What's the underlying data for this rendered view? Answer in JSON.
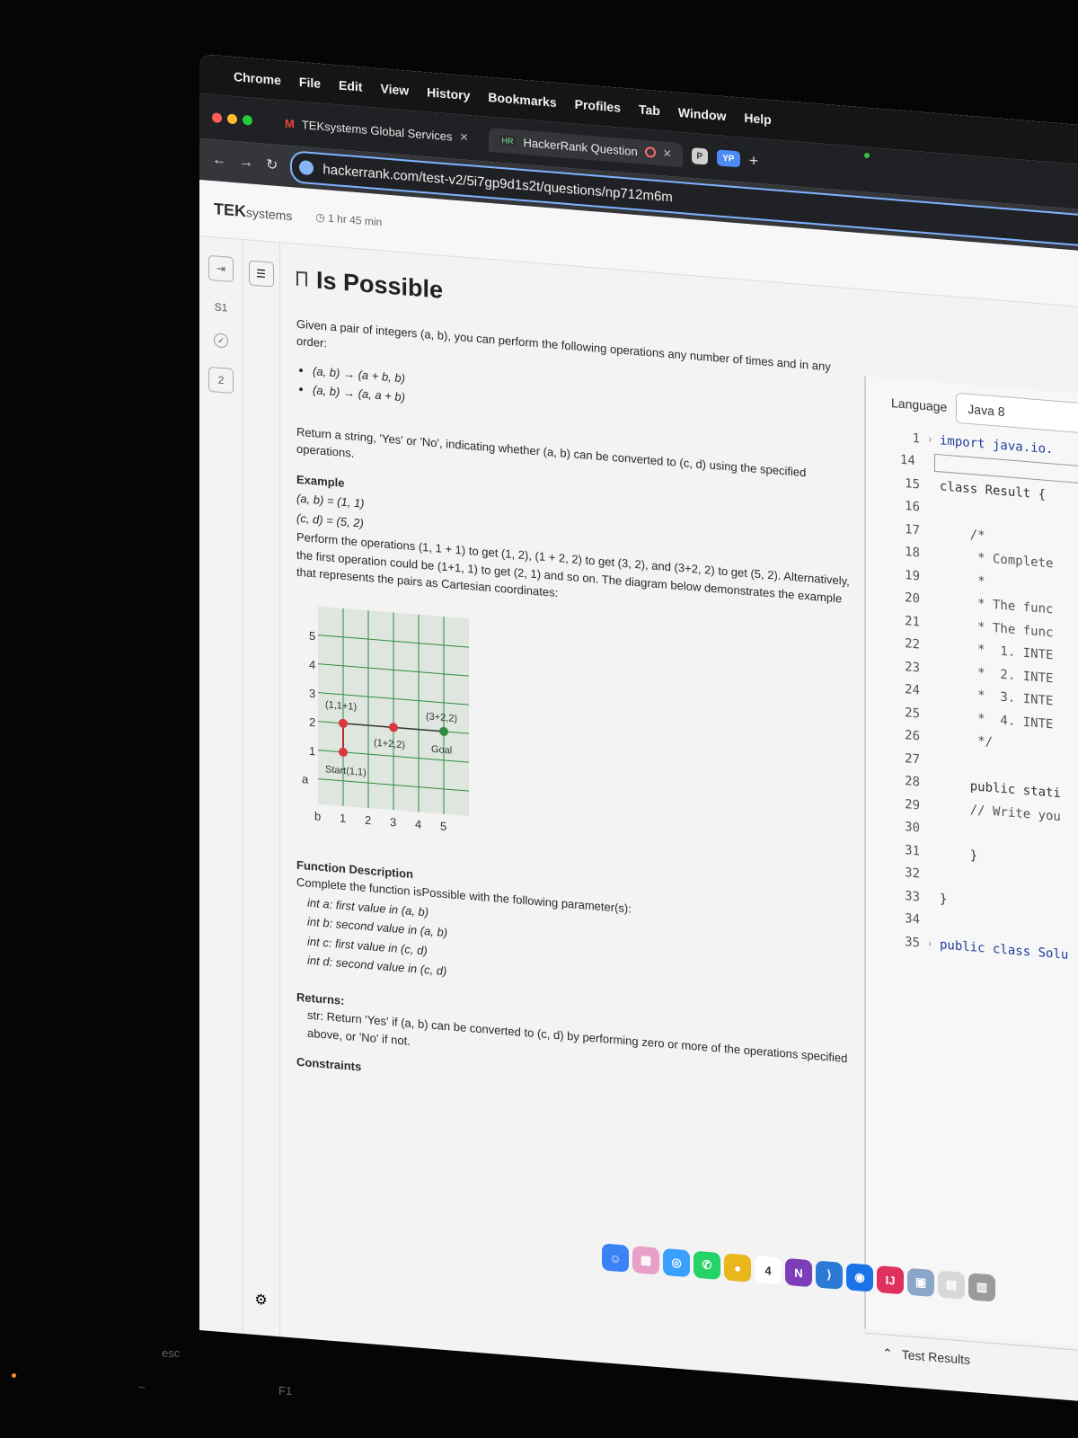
{
  "menubar": {
    "app": "Chrome",
    "items": [
      "File",
      "Edit",
      "View",
      "History",
      "Bookmarks",
      "Profiles",
      "Tab",
      "Window",
      "Help"
    ]
  },
  "tabs": [
    {
      "label": "TEKsystems Global Services",
      "icon": "gmail-icon"
    },
    {
      "label": "HackerRank Question",
      "icon": "hackerrank-icon"
    }
  ],
  "profile_chips": [
    "P",
    "YP"
  ],
  "address": {
    "url": "hackerrank.com/test-v2/5i7gp9d1s2t/questions/np712m6m"
  },
  "header": {
    "logo": "TEK",
    "logo_suffix": "systems",
    "timer": "1 hr 45 min"
  },
  "rail": {
    "section": "S1",
    "question_number": "2"
  },
  "problem": {
    "title": "Is Possible",
    "intro": "Given a pair of integers (a, b), you can perform the following operations any number of times and in any order:",
    "operations": [
      "(a, b) → (a + b, b)",
      "(a, b) → (a, a + b)"
    ],
    "return_text": "Return a string, 'Yes' or 'No', indicating whether (a, b) can be converted to (c, d) using the specified operations.",
    "example_heading": "Example",
    "example_lines": [
      "(a, b) = (1, 1)",
      "(c, d) = (5, 2)"
    ],
    "example_explanation": "Perform the operations (1, 1 + 1) to get (1, 2), (1 + 2, 2) to get (3, 2), and (3+2, 2) to get (5, 2). Alternatively, the first operation could be (1+1, 1) to get (2, 1) and so on. The diagram below demonstrates the example that represents the pairs as Cartesian coordinates:",
    "function_heading": "Function Description",
    "function_intro": "Complete the function isPossible with the following parameter(s):",
    "params": [
      "int a:  first value in (a, b)",
      "int b:  second value in (a, b)",
      "int c:  first value in (c, d)",
      "int d:  second value in (c, d)"
    ],
    "returns_heading": "Returns:",
    "returns_text": "str: Return 'Yes' if (a, b) can be converted to (c, d) by performing zero or more of the operations specified above, or 'No' if not.",
    "constraints_heading": "Constraints"
  },
  "diagram": {
    "y_axis_label": "a",
    "x_axis_label": "b",
    "y_ticks": [
      "1",
      "2",
      "3",
      "4",
      "5"
    ],
    "x_ticks": [
      "1",
      "2",
      "3",
      "4",
      "5"
    ],
    "points": [
      {
        "label": "Start(1,1)",
        "color": "#d9363e"
      },
      {
        "label": "(1,1+1)",
        "color": "#d9363e"
      },
      {
        "label": "(1+2,2)",
        "color": "#d9363e"
      },
      {
        "label": "(3+2,2)",
        "color": "#2e8b3e"
      }
    ],
    "goal_label": "Goal",
    "grid_color": "#2e8b3e",
    "background": "#dfe6df"
  },
  "editor": {
    "language_label": "Language",
    "language_value": "Java 8",
    "lines": [
      {
        "num": "1",
        "text": "import java.io.",
        "fold": true,
        "style": "kw"
      },
      {
        "num": "14",
        "text": "",
        "box": true
      },
      {
        "num": "15",
        "text": "class Result {",
        "style": ""
      },
      {
        "num": "16",
        "text": ""
      },
      {
        "num": "17",
        "text": "    /*",
        "style": "cm"
      },
      {
        "num": "18",
        "text": "     * Complete",
        "style": "cm"
      },
      {
        "num": "19",
        "text": "     *",
        "style": "cm"
      },
      {
        "num": "20",
        "text": "     * The func",
        "style": "cm"
      },
      {
        "num": "21",
        "text": "     * The func",
        "style": "cm"
      },
      {
        "num": "22",
        "text": "     *  1. INTE",
        "style": "cm"
      },
      {
        "num": "23",
        "text": "     *  2. INTE",
        "style": "cm"
      },
      {
        "num": "24",
        "text": "     *  3. INTE",
        "style": "cm"
      },
      {
        "num": "25",
        "text": "     *  4. INTE",
        "style": "cm"
      },
      {
        "num": "26",
        "text": "     */",
        "style": "cm"
      },
      {
        "num": "27",
        "text": ""
      },
      {
        "num": "28",
        "text": "    public stati",
        "style": ""
      },
      {
        "num": "29",
        "text": "    // Write you",
        "style": "cm"
      },
      {
        "num": "30",
        "text": ""
      },
      {
        "num": "31",
        "text": "    }",
        "style": ""
      },
      {
        "num": "32",
        "text": ""
      },
      {
        "num": "33",
        "text": "}",
        "style": ""
      },
      {
        "num": "34",
        "text": ""
      },
      {
        "num": "35",
        "text": "public class Solu",
        "fold": true,
        "style": "kw"
      }
    ],
    "test_results": "Test Results"
  },
  "dock": [
    {
      "name": "finder-icon",
      "color": "#3b82f6",
      "glyph": "☺"
    },
    {
      "name": "launchpad-icon",
      "color": "#e7a0c8",
      "glyph": "▦"
    },
    {
      "name": "safari-icon",
      "color": "#3aa0ff",
      "glyph": "◎"
    },
    {
      "name": "whatsapp-icon",
      "color": "#25d366",
      "glyph": "✆"
    },
    {
      "name": "chrome-icon",
      "color": "#e9b61c",
      "glyph": "●"
    },
    {
      "name": "calendar-icon",
      "color": "#ffffff",
      "glyph": "4"
    },
    {
      "name": "onenote-icon",
      "color": "#7b3db8",
      "glyph": "N"
    },
    {
      "name": "vscode-icon",
      "color": "#2b7bd6",
      "glyph": "⟩"
    },
    {
      "name": "maps-icon",
      "color": "#1a73e8",
      "glyph": "◉"
    },
    {
      "name": "intellij-icon",
      "color": "#e0305e",
      "glyph": "IJ"
    },
    {
      "name": "preview-icon",
      "color": "#8aa6c8",
      "glyph": "▣"
    },
    {
      "name": "archive-icon",
      "color": "#d8d8d8",
      "glyph": "▤"
    },
    {
      "name": "trash-icon",
      "color": "#9a9a9a",
      "glyph": "▥"
    }
  ],
  "keyboard": {
    "esc": "esc",
    "tilde": "~",
    "f1": "F1"
  }
}
